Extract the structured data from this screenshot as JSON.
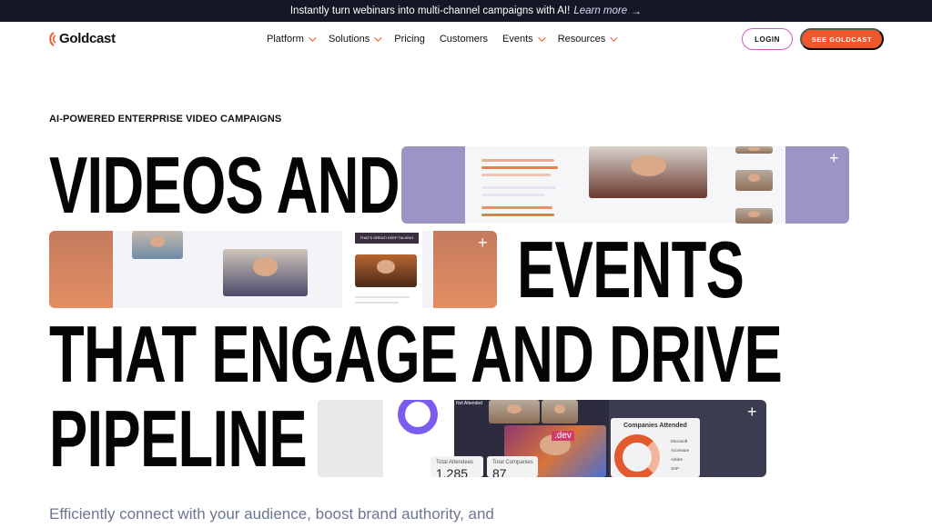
{
  "announcement": {
    "text": "Instantly turn webinars into multi-channel campaigns with AI!",
    "link": "Learn more",
    "arrow": "→"
  },
  "header": {
    "brand": "Goldcast",
    "nav": [
      {
        "label": "Platform",
        "has_dropdown": true
      },
      {
        "label": "Solutions",
        "has_dropdown": true
      },
      {
        "label": "Pricing",
        "has_dropdown": false
      },
      {
        "label": "Customers",
        "has_dropdown": false
      },
      {
        "label": "Events",
        "has_dropdown": true
      },
      {
        "label": "Resources",
        "has_dropdown": true
      }
    ],
    "login_label": "LOGIN",
    "cta_label": "SEE GOLDCAST"
  },
  "hero": {
    "eyebrow": "AI-POWERED ENTERPRISE VIDEO CAMPAIGNS",
    "line1": "VIDEOS AND",
    "line2": "EVENTS",
    "line3": "THAT ENGAGE AND DRIVE",
    "line4": "PIPELINE",
    "subtitle": "Efficiently connect with your audience, boost brand authority, and"
  },
  "cards": {
    "plus_symbol": "+",
    "card2_banner": "THAT'S GREAT! KEEP TALKING ABOUT",
    "card3": {
      "not_attended": "Not Attended",
      "companies_title": "Companies Attended",
      "companies": [
        "Microsoft",
        "Accenture",
        "Adobe",
        "SAP"
      ],
      "total_attendees_label": "Total Attendees",
      "total_attendees_value": "1,285",
      "total_companies_label": "Total Companies",
      "total_companies_value": "87",
      "dev_tag": ".dev"
    }
  },
  "colors": {
    "accent": "#f0582b",
    "login_border": "#d45ac3",
    "announce_bg": "#141826",
    "subtitle": "#6c7694"
  }
}
